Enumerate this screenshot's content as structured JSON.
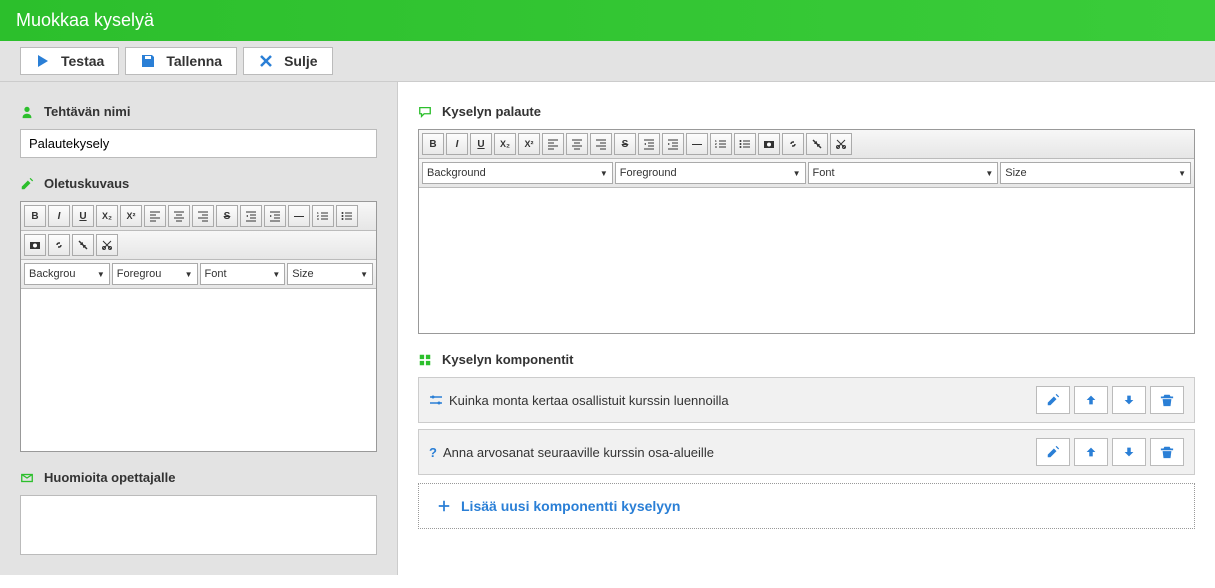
{
  "header": {
    "title": "Muokkaa kyselyä"
  },
  "toolbar": {
    "test": "Testaa",
    "save": "Tallenna",
    "close": "Sulje"
  },
  "left": {
    "task_name_label": "Tehtävän nimi",
    "task_name_value": "Palautekysely",
    "desc_label": "Oletuskuvaus",
    "notes_label": "Huomioita opettajalle"
  },
  "right": {
    "feedback_label": "Kyselyn palaute",
    "components_label": "Kyselyn komponentit",
    "add_component": "Lisää uusi komponentti kyselyyn"
  },
  "editor_selects": {
    "bg": "Background",
    "fg": "Foreground",
    "font": "Font",
    "size": "Size"
  },
  "editor_selects_short": {
    "bg": "Backgrou",
    "fg": "Foregrou",
    "font": "Font",
    "size": "Size"
  },
  "components": [
    {
      "text": "Kuinka monta kertaa osallistuit kurssin luennoilla",
      "icon": "slider"
    },
    {
      "text": "Anna arvosanat seuraaville kurssin osa-alueille",
      "icon": "question"
    }
  ]
}
